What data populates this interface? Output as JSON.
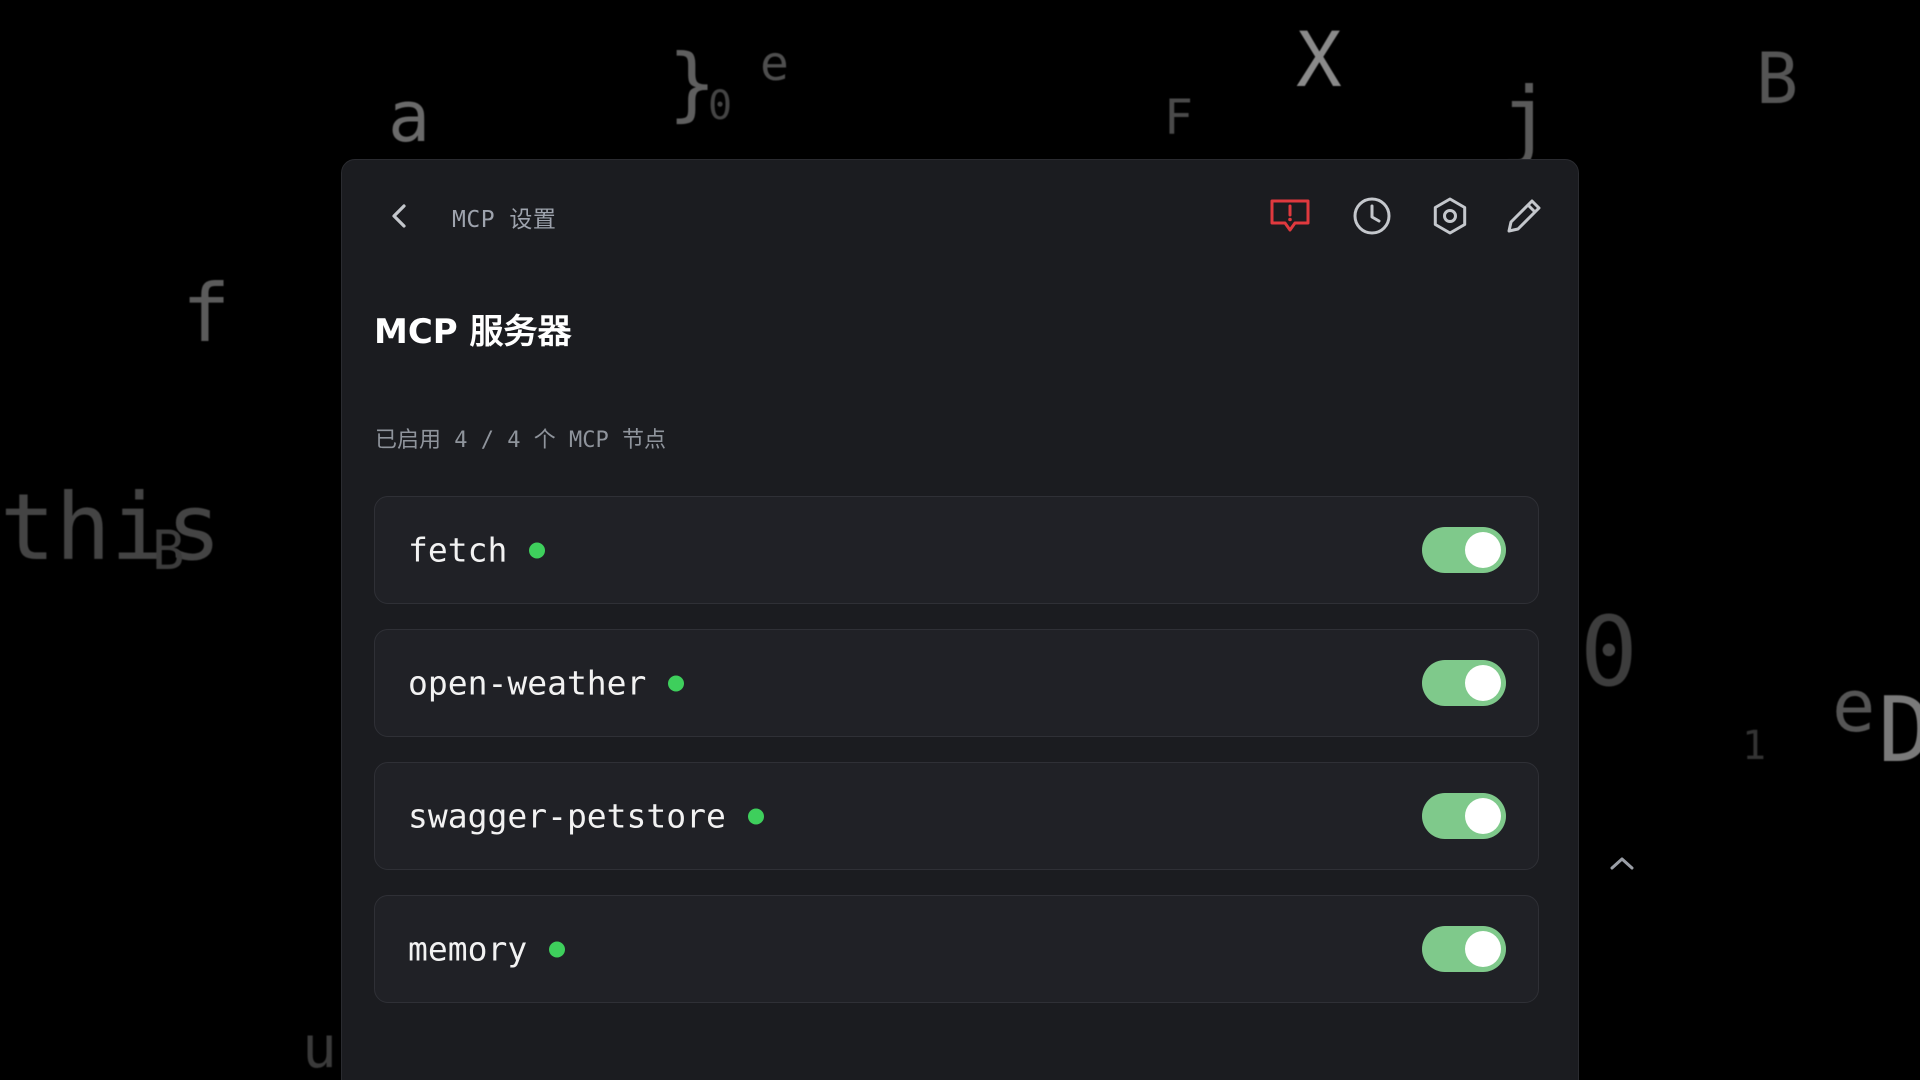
{
  "header": {
    "breadcrumb": "MCP 设置",
    "icons": {
      "back": "chevron-left-icon",
      "feedback": "feedback-alert-icon",
      "history": "clock-icon",
      "settings": "gear-icon",
      "edit": "pencil-icon"
    }
  },
  "main": {
    "title": "MCP 服务器",
    "summary": "已启用 4 / 4 个 MCP 节点",
    "servers": [
      {
        "name": "fetch",
        "status": "active",
        "enabled": true
      },
      {
        "name": "open-weather",
        "status": "active",
        "enabled": true
      },
      {
        "name": "swagger-petstore",
        "status": "active",
        "enabled": true
      },
      {
        "name": "memory",
        "status": "active",
        "enabled": true
      }
    ]
  },
  "colors": {
    "panel_bg": "#1b1c20",
    "card_bg": "#202126",
    "status_active": "#3ecf5c",
    "toggle_on": "#7fc98b",
    "feedback_icon": "#e0393e"
  }
}
